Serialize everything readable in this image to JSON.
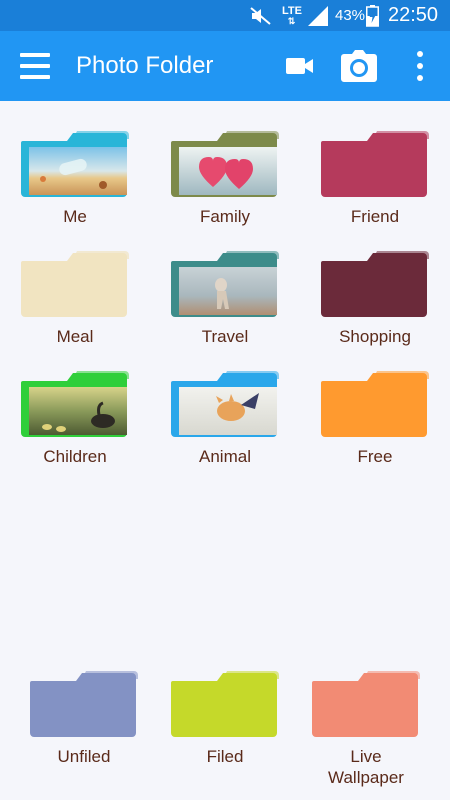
{
  "status_bar": {
    "network": "LTE",
    "battery_percent": "43%",
    "time": "22:50",
    "icons": [
      "mute-icon",
      "signal-icon",
      "battery-charging-icon"
    ]
  },
  "app_bar": {
    "title": "Photo Folder",
    "icons": [
      "menu-icon",
      "video-camera-icon",
      "camera-icon",
      "more-vertical-icon"
    ]
  },
  "folders": [
    {
      "label": "Me",
      "color": "#29b5d8",
      "has_photo": true,
      "photo": "beach-bottle"
    },
    {
      "label": "Family",
      "color": "#7d8a4a",
      "has_photo": true,
      "photo": "pink-hearts"
    },
    {
      "label": "Friend",
      "color": "#b53a5c",
      "has_photo": false
    },
    {
      "label": "Meal",
      "color": "#f1e4c1",
      "has_photo": false
    },
    {
      "label": "Travel",
      "color": "#3d8c8a",
      "has_photo": true,
      "photo": "dog-on-beach"
    },
    {
      "label": "Shopping",
      "color": "#6b2a3a",
      "has_photo": false
    },
    {
      "label": "Children",
      "color": "#2fcf3a",
      "has_photo": true,
      "photo": "geese-pond"
    },
    {
      "label": "Animal",
      "color": "#2aa7ea",
      "has_photo": true,
      "photo": "jumping-kitten"
    },
    {
      "label": "Free",
      "color": "#ff9a2f",
      "has_photo": false
    },
    {
      "label": "Unfiled",
      "color": "#8392c4",
      "has_photo": false
    },
    {
      "label": "Filed",
      "color": "#c5d92a",
      "has_photo": false
    },
    {
      "label": "Live\nWallpaper",
      "color": "#f28b74",
      "has_photo": false
    }
  ]
}
